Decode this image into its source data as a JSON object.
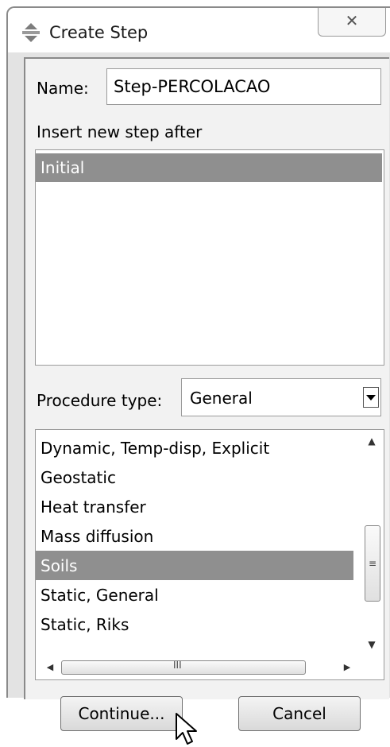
{
  "window": {
    "title": "Create Step",
    "close_glyph": "✕"
  },
  "name_field": {
    "label": "Name:",
    "value": "Step-PERCOLACAO"
  },
  "insert_after": {
    "label": "Insert new step after",
    "items": [
      "Initial"
    ],
    "selected": "Initial"
  },
  "procedure": {
    "label": "Procedure type:",
    "selected": "General",
    "items": [
      "Dynamic, Temp-disp, Explicit",
      "Geostatic",
      "Heat transfer",
      "Mass diffusion",
      "Soils",
      "Static, General",
      "Static, Riks"
    ],
    "selected_item": "Soils"
  },
  "scrollbars": {
    "up_glyph": "▲",
    "down_glyph": "▼",
    "left_glyph": "◀",
    "right_glyph": "▶",
    "v_grip": "≡",
    "h_grip": "III"
  },
  "buttons": {
    "continue_label": "Continue...",
    "cancel_label": "Cancel"
  },
  "icons": {
    "title_icon": "step-icon",
    "cursor": "pointer-cursor"
  }
}
